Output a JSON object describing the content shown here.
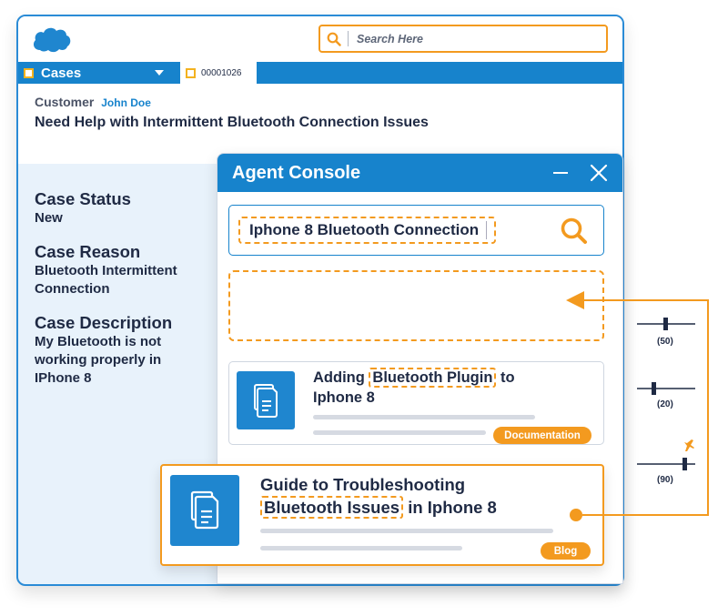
{
  "search": {
    "placeholder": "Search Here"
  },
  "tabs": {
    "cases_label": "Cases",
    "record_number": "00001026"
  },
  "case": {
    "customer_label": "Customer",
    "customer_name": "John Doe",
    "subject": "Need Help with Intermittent Bluetooth Connection Issues"
  },
  "details": {
    "status_label": "Case Status",
    "status_value": "New",
    "reason_label": "Case Reason",
    "reason_value_1": "Bluetooth Intermittent",
    "reason_value_2": "Connection",
    "description_label": "Case Description",
    "description_1": "My Bluetooth is not",
    "description_2": "working properly in",
    "description_3": "IPhone 8"
  },
  "console": {
    "title": "Agent Console",
    "query": "Iphone 8 Bluetooth Connection",
    "results": [
      {
        "title_pre": "Adding",
        "title_hl": "Bluetooth Plugin",
        "title_post": "to",
        "title_line2": "Iphone 8",
        "tag": "Documentation"
      },
      {
        "title_line1": "Guide to Troubleshooting",
        "title_hl": "Bluetooth Issues",
        "title_post": "in Iphone 8",
        "tag": "Blog"
      }
    ]
  },
  "sliders": [
    {
      "label": "(50)",
      "value": 50
    },
    {
      "label": "(20)",
      "value": 20
    },
    {
      "label": "(90)",
      "value": 90
    }
  ],
  "colors": {
    "brand_blue": "#1783cc",
    "accent_orange": "#f39a1f",
    "dark_text": "#1f2a44"
  }
}
